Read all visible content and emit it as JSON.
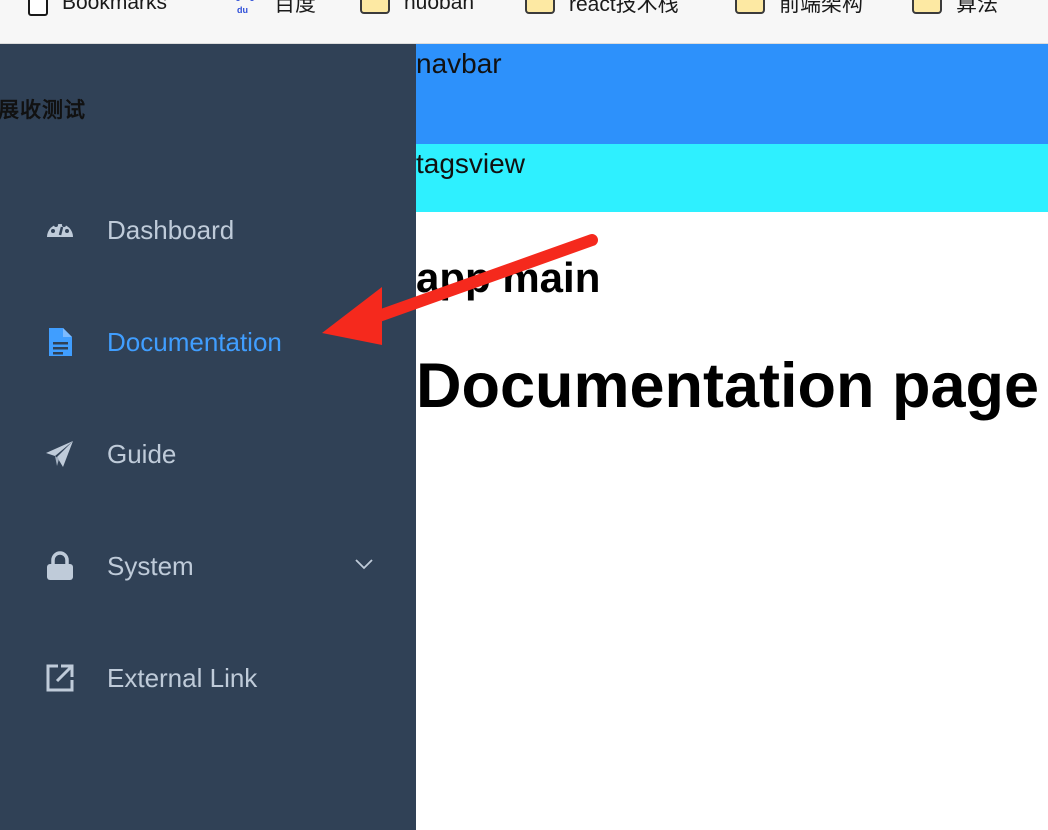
{
  "bookmarks_bar": {
    "items": [
      {
        "label": "Bookmarks",
        "icon": "document-icon"
      },
      {
        "label": "百度",
        "icon": "baidu-icon"
      },
      {
        "label": "huoban",
        "icon": "folder-icon"
      },
      {
        "label": "react技术栈",
        "icon": "folder-icon"
      },
      {
        "label": "前端架构",
        "icon": "folder-icon"
      },
      {
        "label": "算法",
        "icon": "folder-icon"
      }
    ]
  },
  "sidebar": {
    "title": "展收测试",
    "background": "#304156",
    "text_color": "#bfcbd9",
    "active_color": "#409eff",
    "items": [
      {
        "label": "Dashboard",
        "icon": "dashboard-icon",
        "active": false
      },
      {
        "label": "Documentation",
        "icon": "document-icon",
        "active": true
      },
      {
        "label": "Guide",
        "icon": "paper-plane-icon",
        "active": false
      },
      {
        "label": "System",
        "icon": "lock-icon",
        "active": false,
        "has_submenu": true
      },
      {
        "label": "External Link",
        "icon": "external-link-icon",
        "active": false
      }
    ]
  },
  "navbar": {
    "label": "navbar",
    "background": "#2d91fb"
  },
  "tagsview": {
    "label": "tagsview",
    "background": "#2ef0ff"
  },
  "main": {
    "title": "app main",
    "page_heading": "Documentation page"
  },
  "annotation": {
    "color": "#f5291d"
  }
}
